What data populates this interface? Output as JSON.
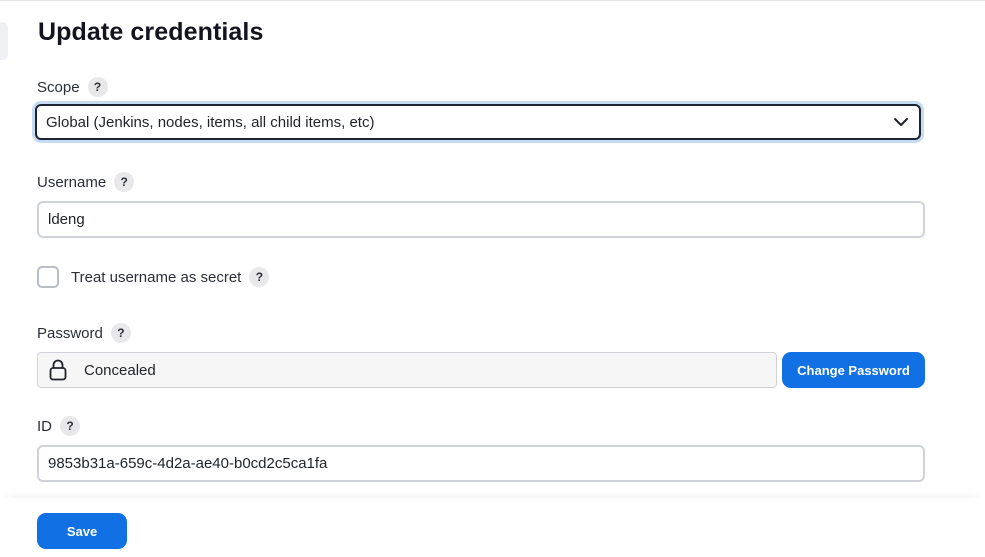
{
  "page": {
    "title": "Update credentials"
  },
  "scope": {
    "label": "Scope",
    "help": "?",
    "selected": "Global (Jenkins, nodes, items, all child items, etc)"
  },
  "username": {
    "label": "Username",
    "help": "?",
    "value": "ldeng"
  },
  "secret": {
    "label": "Treat username as secret",
    "help": "?",
    "checked": false
  },
  "password": {
    "label": "Password",
    "help": "?",
    "value": "Concealed",
    "icon": "lock-icon",
    "change_label": "Change Password"
  },
  "id": {
    "label": "ID",
    "help": "?",
    "value": "9853b31a-659c-4d2a-ae40-b0cd2c5ca1fa"
  },
  "footer": {
    "save_label": "Save"
  },
  "colors": {
    "primary": "#1170e4",
    "focus_ring": "#c7dcf2"
  }
}
